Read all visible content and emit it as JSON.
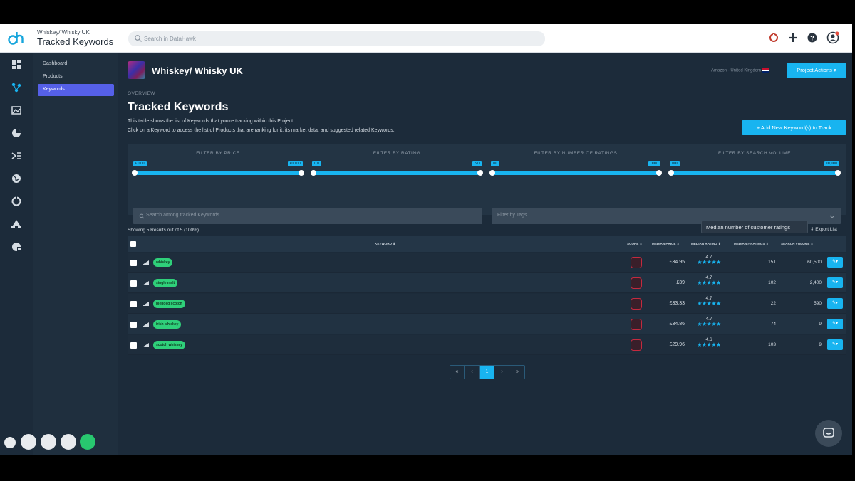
{
  "header": {
    "project_sub": "Whiskey/ Whisky UK",
    "page_title": "Tracked Keywords",
    "search_placeholder": "Search in DataHawk"
  },
  "sidebar": {
    "items": [
      {
        "label": "Dashboard"
      },
      {
        "label": "Products"
      },
      {
        "label": "Keywords"
      }
    ]
  },
  "project": {
    "name": "Whiskey/ Whisky UK",
    "marketplace": "Amazon - United Kingdom",
    "actions_label": "Project Actions ▾"
  },
  "page": {
    "section": "OVERVIEW",
    "title": "Tracked Keywords",
    "desc1": "This table shows the list of Keywords that you're tracking within this Project.",
    "desc2": "Click on a Keyword to access the list of Products that are ranking for it, its market data, and suggested related Keywords.",
    "add_button": "+ Add New Keyword(s) to Track"
  },
  "filters": [
    {
      "label": "FILTER BY PRICE",
      "min": "£0.00",
      "max": "£00.00"
    },
    {
      "label": "FILTER BY RATING",
      "min": "0.0",
      "max": "5.0"
    },
    {
      "label": "FILTER BY NUMBER OF RATINGS",
      "min": "00",
      "max": "0000"
    },
    {
      "label": "FILTER BY SEARCH VOLUME",
      "min": "000",
      "max": "00,000"
    }
  ],
  "search_keywords_placeholder": "Search among tracked Keywords",
  "tags_placeholder": "Filter by Tags",
  "results": {
    "showing": "Showing 5 Results out of 5 (100%)",
    "tooltip": "Median number of customer ratings",
    "export": "Export List"
  },
  "table": {
    "headers": {
      "keyword": "KEYWORD ⬍",
      "score": "SCORE ⬍",
      "price": "MEDIAN PRICE ⬍",
      "rating": "MEDIAN RATING ⬍",
      "nratings": "MEDIAN # RATINGS ⬍",
      "volume": "SEARCH VOLUME ⬍"
    },
    "rows": [
      {
        "keyword": "whiskey",
        "price": "£34.95",
        "rating": "4.7",
        "nratings": "151",
        "volume": "60,500"
      },
      {
        "keyword": "single malt",
        "price": "£39",
        "rating": "4.7",
        "nratings": "102",
        "volume": "2,400"
      },
      {
        "keyword": "blended scotch",
        "price": "£33.33",
        "rating": "4.7",
        "nratings": "22",
        "volume": "590"
      },
      {
        "keyword": "irish whiskey",
        "price": "£34.86",
        "rating": "4.7",
        "nratings": "74",
        "volume": "9"
      },
      {
        "keyword": "scotch whiskey",
        "price": "£29.96",
        "rating": "4.6",
        "nratings": "103",
        "volume": "9"
      }
    ]
  },
  "pagination": {
    "prev2": "«",
    "prev": "‹",
    "current": "1",
    "next": "›",
    "next2": "»"
  },
  "colors": {
    "accent": "#18b4f0",
    "tag": "#2fd07a",
    "nav_active": "#5560e8"
  }
}
